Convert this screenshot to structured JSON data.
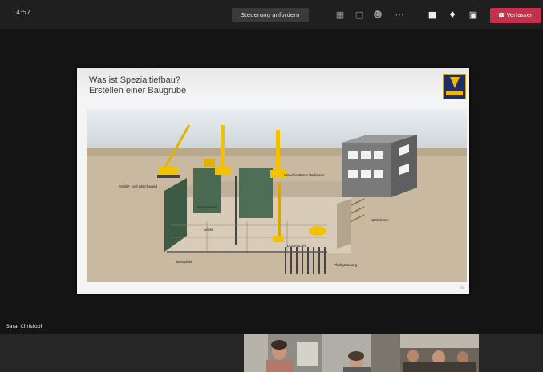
{
  "meeting": {
    "timer": "14:57",
    "control_button": "Steuerung anfordern",
    "leave_button": "Verlassen",
    "icons": [
      "grid-icon",
      "chat-icon",
      "participants-icon",
      "more-icon",
      "camera-icon",
      "microphone-icon",
      "share-screen-icon",
      "phone-hangup-icon"
    ],
    "presenter_name": "Sara, Christoph"
  },
  "slide": {
    "title_line1": "Was ist Spezialtiefbau?",
    "title_line2": "Erstellen einer Baugrube",
    "page_number": "10",
    "labels": {
      "schlitz": "Schlitz- und Weichwand",
      "anker": "Anker",
      "spundwand": "Spundwand",
      "bohrpfahl": "Bohrpfahl",
      "mixed": "Mixed-in-Place Verfahren",
      "spritz": "Spritzbeton",
      "duesen": "Düsenstrahl",
      "pfahl": "Pfahlgründung"
    }
  },
  "colors": {
    "leave": "#c4314b",
    "crane_yellow": "#f2c200",
    "logo_blue": "#1a2f6b"
  }
}
